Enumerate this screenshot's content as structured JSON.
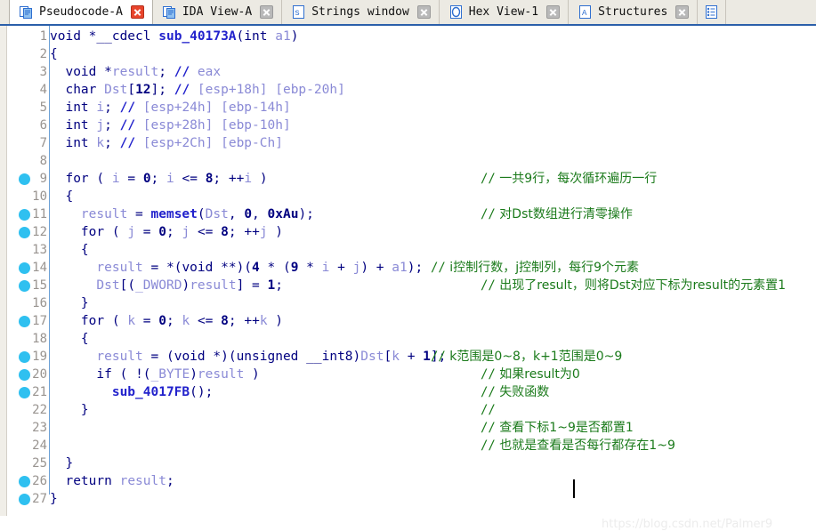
{
  "tabs": [
    {
      "label": "Pseudocode-A",
      "icon": "pseudocode-icon",
      "active": true,
      "close_icon": "close-icon-red"
    },
    {
      "label": "IDA View-A",
      "icon": "ida-view-icon",
      "active": false,
      "close_icon": "close-icon"
    },
    {
      "label": "Strings window",
      "icon": "strings-icon",
      "active": false,
      "close_icon": "close-icon"
    },
    {
      "label": "Hex View-1",
      "icon": "hex-view-icon",
      "active": false,
      "close_icon": "close-icon"
    },
    {
      "label": "Structures",
      "icon": "structures-icon",
      "active": false,
      "close_icon": "close-icon"
    },
    {
      "label": "",
      "icon": "enums-icon",
      "active": false,
      "close_icon": ""
    }
  ],
  "colors": {
    "tabbar_bg": "#eceae3",
    "tabbar_underline": "#2b5faa",
    "active_tab_bg": "#ffffff",
    "breakpoint": "#2fc0f0",
    "line_number": "#999490",
    "keyword": "#000080",
    "variable": "#8a8ad6",
    "function": "#2222cc",
    "comment_blue": "#8a8ad6",
    "comment_green": "#1a7a1a",
    "vertical_guide": "#6a9fd4",
    "watermark": "#ececec"
  },
  "editor": {
    "cursor_line": 25,
    "lines": [
      {
        "n": 1,
        "bp": false,
        "code": "void *__cdecl sub_40173A(int a1)",
        "comment": ""
      },
      {
        "n": 2,
        "bp": false,
        "code": "{",
        "comment": ""
      },
      {
        "n": 3,
        "bp": false,
        "code": "  void *result; // eax",
        "comment": ""
      },
      {
        "n": 4,
        "bp": false,
        "code": "  char Dst[12]; // [esp+18h] [ebp-20h]",
        "comment": ""
      },
      {
        "n": 5,
        "bp": false,
        "code": "  int i; // [esp+24h] [ebp-14h]",
        "comment": ""
      },
      {
        "n": 6,
        "bp": false,
        "code": "  int j; // [esp+28h] [ebp-10h]",
        "comment": ""
      },
      {
        "n": 7,
        "bp": false,
        "code": "  int k; // [esp+2Ch] [ebp-Ch]",
        "comment": ""
      },
      {
        "n": 8,
        "bp": false,
        "code": "",
        "comment": ""
      },
      {
        "n": 9,
        "bp": true,
        "code": "  for ( i = 0; i <= 8; ++i )",
        "comment": "// 一共9行，每次循环遍历一行"
      },
      {
        "n": 10,
        "bp": false,
        "code": "  {",
        "comment": ""
      },
      {
        "n": 11,
        "bp": true,
        "code": "    result = memset(Dst, 0, 0xAu);",
        "comment": "// 对Dst数组进行清零操作"
      },
      {
        "n": 12,
        "bp": true,
        "code": "    for ( j = 0; j <= 8; ++j )",
        "comment": ""
      },
      {
        "n": 13,
        "bp": false,
        "code": "    {",
        "comment": ""
      },
      {
        "n": 14,
        "bp": true,
        "code": "      result = *(void **)(4 * (9 * i + j) + a1);",
        "comment": "// i控制行数，j控制列，每行9个元素"
      },
      {
        "n": 15,
        "bp": true,
        "code": "      Dst[(_DWORD)result] = 1;",
        "comment": "// 出现了result，则将Dst对应下标为result的元素置1"
      },
      {
        "n": 16,
        "bp": false,
        "code": "    }",
        "comment": ""
      },
      {
        "n": 17,
        "bp": true,
        "code": "    for ( k = 0; k <= 8; ++k )",
        "comment": ""
      },
      {
        "n": 18,
        "bp": false,
        "code": "    {",
        "comment": ""
      },
      {
        "n": 19,
        "bp": true,
        "code": "      result = (void *)(unsigned __int8)Dst[k + 1];",
        "comment": "// k范围是0~8，k+1范围是0~9"
      },
      {
        "n": 20,
        "bp": true,
        "code": "      if ( !(_BYTE)result )",
        "comment": "// 如果result为0"
      },
      {
        "n": 21,
        "bp": true,
        "code": "        sub_4017FB();",
        "comment": "// 失败函数"
      },
      {
        "n": 22,
        "bp": false,
        "code": "    }",
        "comment": "//"
      },
      {
        "n": 23,
        "bp": false,
        "code": "",
        "comment": "// 查看下标1~9是否都置1"
      },
      {
        "n": 24,
        "bp": false,
        "code": "",
        "comment": "// 也就是查看是否每行都存在1~9"
      },
      {
        "n": 25,
        "bp": false,
        "code": "  }",
        "comment": ""
      },
      {
        "n": 26,
        "bp": true,
        "code": "  return result;",
        "comment": ""
      },
      {
        "n": 27,
        "bp": true,
        "code": "}",
        "comment": ""
      }
    ]
  },
  "watermark": {
    "text": "https://blog.csdn.net/Palmer9"
  }
}
